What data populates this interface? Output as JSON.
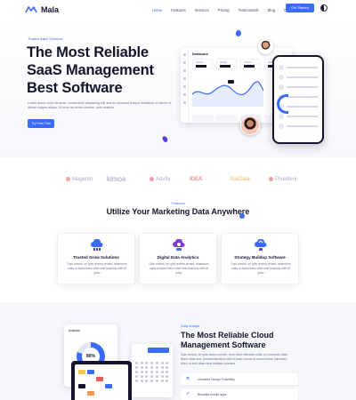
{
  "nav": {
    "logo": "Mala",
    "items": [
      {
        "label": "Home",
        "active": true
      },
      {
        "label": "Features",
        "active": false
      },
      {
        "label": "Services",
        "active": false
      },
      {
        "label": "Pricing",
        "active": false
      },
      {
        "label": "Testimonials",
        "active": false
      },
      {
        "label": "Blog",
        "active": false
      },
      {
        "label": "Contact",
        "active": false
      }
    ],
    "cta": "Get Started"
  },
  "hero": {
    "eyebrow": "Trusted SaaS Solutions",
    "title_line1": "The Most Reliable",
    "title_line2": "SaaS Management",
    "title_line3": "Best Software",
    "description": "Lorem ipsum dolor sit amet, consectetur adipiscing elit, sed do eiusmod tempor incididunt ut labore et dolore magna aliqua. Ut enim ad minim veniam, quis nostrud.",
    "button": "Try Free Trial",
    "dashboard_title": "Dashboard"
  },
  "brands": [
    "Magento",
    "kimoa",
    "Advity",
    "IDEA",
    "AskData",
    "Pixeldeni"
  ],
  "features": {
    "eyebrow": "Features",
    "title": "Utilize Your Marketing Data Anywhere",
    "cards": [
      {
        "title": "Trusted Grow Solutions",
        "desc": "Duis cursus, mi quis viverra ornare, ananstum nulla ut diam libero vitae erat faucibus nibh et justo"
      },
      {
        "title": "Digital Data Analytics",
        "desc": "Duis cursus, mi quis viverra ornare, ananstum nulla ut diam libero vitae erat faucibus nibh et justo"
      },
      {
        "title": "Strategy Buildup Software",
        "desc": "Duis cursus, mi quis viverra ornare, ananstum nulla ut diam libero vitae erat faucibus nibh et justo"
      }
    ]
  },
  "about": {
    "eyebrow": "Data Analyst",
    "title": "The Most Reliable Cloud Management Software",
    "description": "Duis cursus, mi quis viverra ornare, eros dolor interdum nulla, ut commodo diam libero vitae erat. Aenean faucibus nibh et justo cursus id rutrum lorem imperdiet. Nunc ut sem vitae risus tristique posuere.",
    "mock_label": "Analytics",
    "donut_value": "80%",
    "list": [
      {
        "icon": "close-icon",
        "label": "Unlimited Design Possibility"
      },
      {
        "icon": "check-icon",
        "label": "Beautiful mobile apps"
      }
    ]
  },
  "colors": {
    "accent": "#3b6cf6",
    "dark": "#14142b",
    "muted": "#6e7191"
  }
}
